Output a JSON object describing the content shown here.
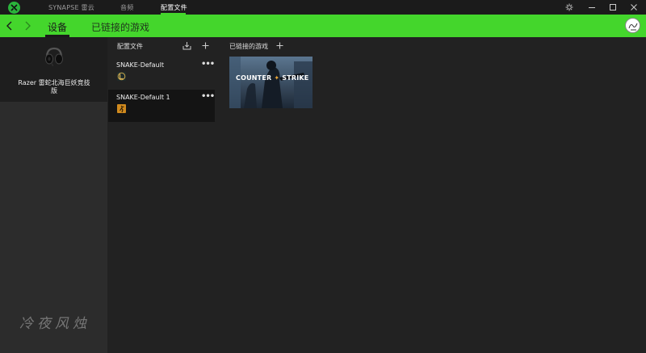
{
  "titlebar": {
    "tabs": [
      {
        "label": "SYNAPSE 雷云"
      },
      {
        "label": "音频"
      },
      {
        "label": "配置文件"
      }
    ]
  },
  "navbar": {
    "device_label": "设备",
    "linked_games_label": "已链接的游戏"
  },
  "device": {
    "name": "Razer 雷蛇北海巨妖竞技版"
  },
  "profiles": {
    "header": "配置文件",
    "items": [
      {
        "name": "SNAKE-Default"
      },
      {
        "name": "SNAKE-Default 1"
      }
    ]
  },
  "linked_games": {
    "header": "已链接的游戏",
    "games": [
      {
        "title_left": "COUNTER",
        "title_right": "STRIKE"
      }
    ]
  },
  "watermark": "冷夜风烛",
  "colors": {
    "accent": "#44d62c",
    "titlebar": "#1b1b1b",
    "background": "#222222",
    "device_panel": "#2c2c2c",
    "selected_profile": "#141414"
  }
}
